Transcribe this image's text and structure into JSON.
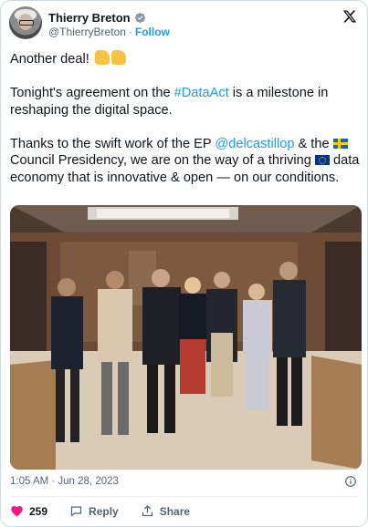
{
  "author": {
    "name": "Thierry Breton",
    "handle": "@ThierryBreton",
    "follow_label": "Follow",
    "separator": "·"
  },
  "tweet": {
    "line1": "Another deal!",
    "p2_before": "Tonight's agreement on the ",
    "p2_hashtag": "#DataAct",
    "p2_after": " is a milestone in reshaping the digital space.",
    "p3_before": "Thanks to the swift work of the EP ",
    "p3_mention": "@delcastillop",
    "p3_mid": " & the ",
    "p3_mid2": " Council Presidency, we are on the way of a thriving ",
    "p3_after": " data economy that is innovative & open — on our conditions."
  },
  "meta": {
    "timestamp": "1:05 AM · Jun 28, 2023"
  },
  "actions": {
    "like_count": "259",
    "reply_label": "Reply",
    "share_label": "Share"
  },
  "colors": {
    "accent": "#1d9bf0",
    "like": "#f91880",
    "muted": "#536471"
  },
  "icons": {
    "verified": "verified-badge-icon",
    "x": "x-logo-icon",
    "info": "info-icon",
    "like": "heart-icon",
    "reply": "reply-bubble-icon",
    "share": "share-icon"
  }
}
